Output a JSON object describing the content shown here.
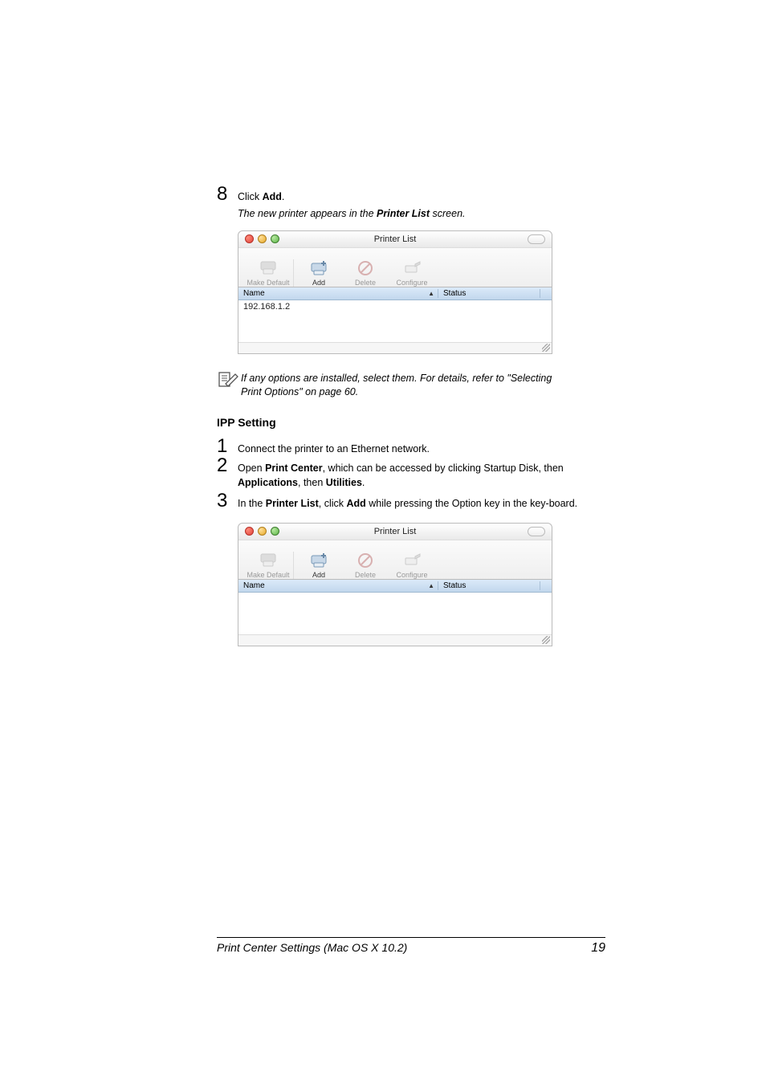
{
  "step8": {
    "num": "8",
    "pre": "Click ",
    "bold": "Add",
    "post": ".",
    "result_pre": "The new printer appears in the ",
    "result_bold": "Printer List",
    "result_post": " screen."
  },
  "window1": {
    "title": "Printer List",
    "tb": {
      "make_default": "Make Default",
      "add": "Add",
      "delete": "Delete",
      "configure": "Configure"
    },
    "headers": {
      "name": "Name",
      "status": "Status"
    },
    "row1": "192.168.1.2"
  },
  "note": {
    "text_pre": "If any options are installed, select them. For details, refer to \"Selecting Print Options\" on page 60.",
    "line2": "Print Options\" on page 60."
  },
  "note_full_line1": "If any options are installed, select them. For details, refer to \"Selecting",
  "section": "IPP Setting",
  "step1": {
    "num": "1",
    "text": "Connect the printer to an Ethernet network."
  },
  "step2": {
    "num": "2",
    "pre": "Open ",
    "b1": "Print Center",
    "mid1": ", which can be accessed by clicking Startup Disk, then ",
    "b2": "Applications",
    "mid2": ", then ",
    "b3": "Utilities",
    "post": "."
  },
  "step3": {
    "num": "3",
    "pre": "In the ",
    "b1": "Printer List",
    "mid1": ", click ",
    "b2": "Add",
    "post": " while pressing the Option key in the key-board."
  },
  "window2": {
    "title": "Printer List",
    "tb": {
      "make_default": "Make Default",
      "add": "Add",
      "delete": "Delete",
      "configure": "Configure"
    },
    "headers": {
      "name": "Name",
      "status": "Status"
    }
  },
  "footer": {
    "left": "Print Center Settings (Mac OS X 10.2)",
    "right": "19"
  }
}
